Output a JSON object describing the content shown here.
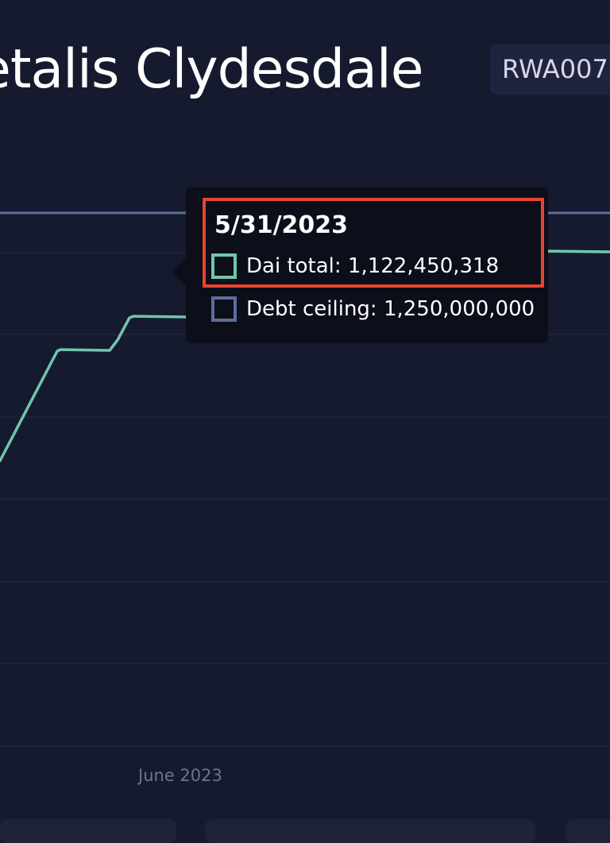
{
  "header": {
    "title": "etalis Clydesdale",
    "badge": "RWA007"
  },
  "colors": {
    "background": "#161a2e",
    "gridline": "#1f233a",
    "dai_total_line": "#6fc6ad",
    "debt_ceiling_line": "#5d6d9c",
    "tooltip_background": "#0c0e19",
    "highlight_box": "#e8452f",
    "axis_label": "#6f7488"
  },
  "tooltip": {
    "date": "5/31/2023",
    "rows": [
      {
        "label": "Dai total: 1,122,450,318",
        "swatch_color": "#6fc6ad",
        "icon": "square-swatch-icon"
      },
      {
        "label": "Debt ceiling: 1,250,000,000",
        "swatch_color": "#5d6d9c",
        "icon": "square-swatch-icon"
      }
    ]
  },
  "x_axis": {
    "tick_labels": [
      "June 2023"
    ]
  },
  "chart_data": {
    "type": "line",
    "title": "",
    "xlabel": "",
    "ylabel": "",
    "x_tick_labels": [
      "June 2023"
    ],
    "grid": true,
    "series": [
      {
        "name": "Dai total",
        "color": "#6fc6ad",
        "x": [
          "5/31/2023"
        ],
        "values": [
          1122450318
        ]
      },
      {
        "name": "Debt ceiling",
        "color": "#5d6d9c",
        "x": [
          "5/31/2023"
        ],
        "values": [
          1250000000
        ]
      }
    ]
  }
}
